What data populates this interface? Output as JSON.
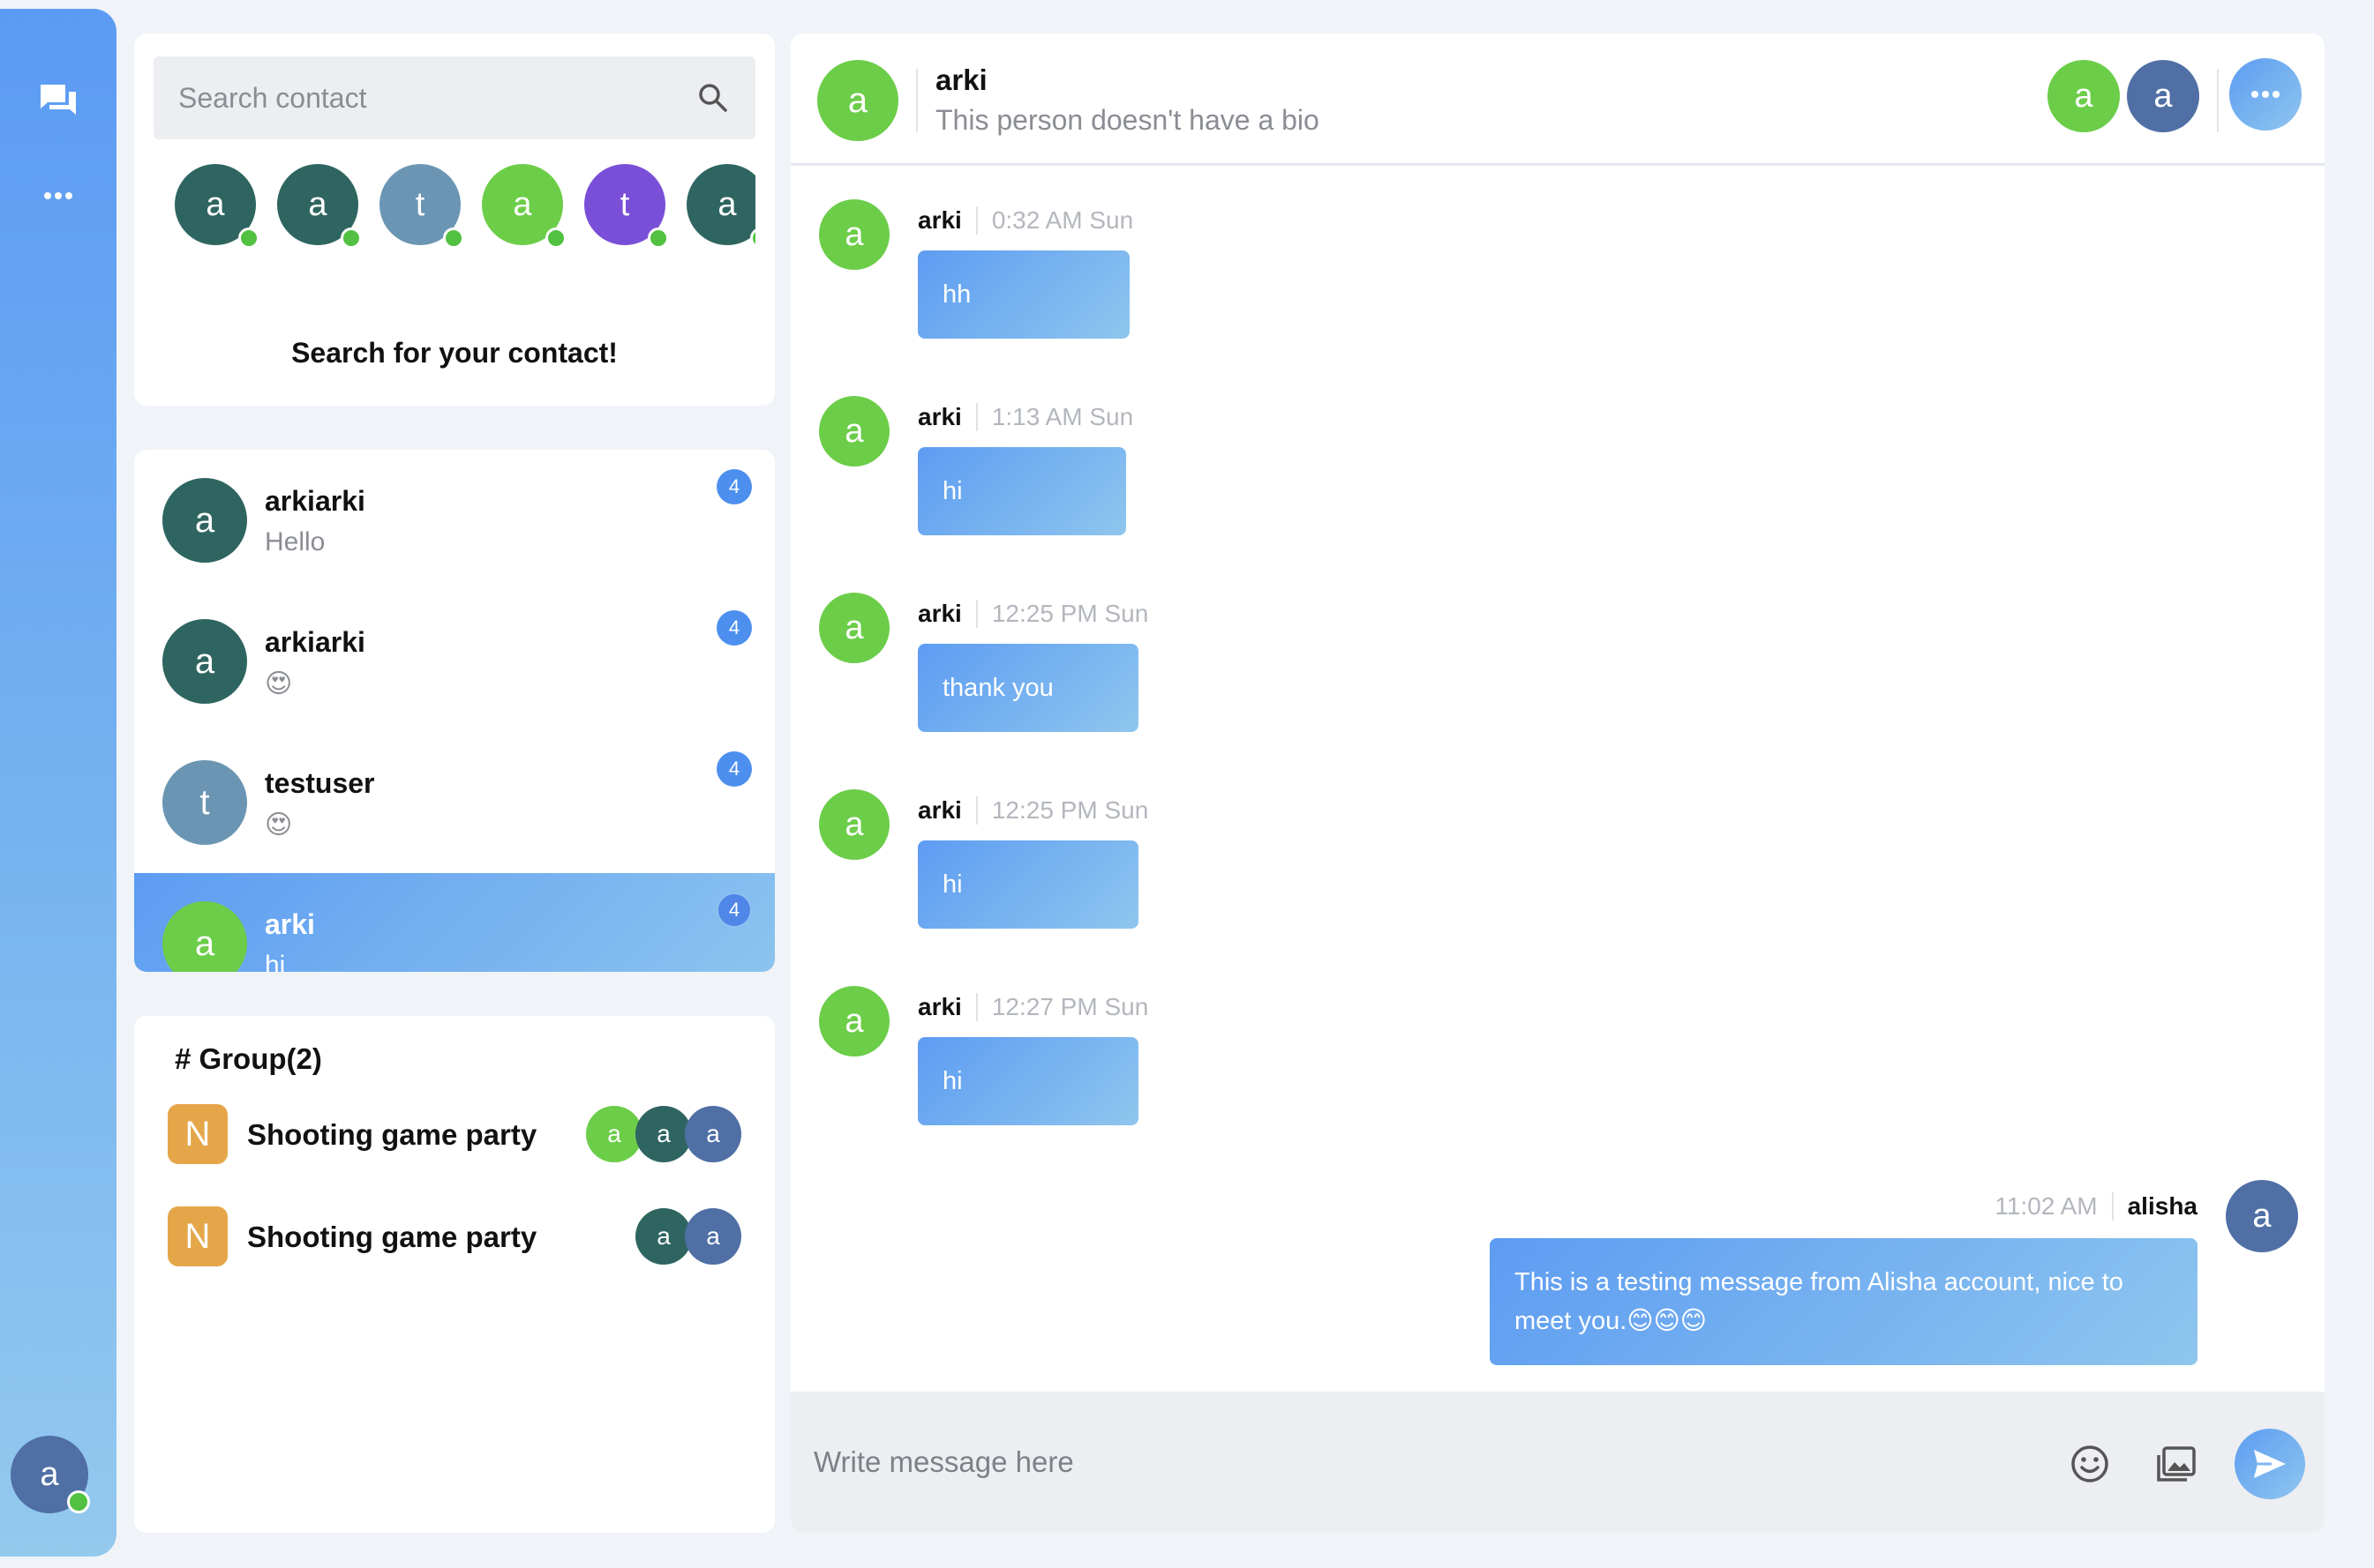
{
  "sidebar": {
    "icons": [
      "chat-icon",
      "more-icon"
    ],
    "user_avatar": "a",
    "user_online": true
  },
  "search": {
    "placeholder": "Search contact",
    "icon": "search-icon",
    "hint": "Search for your contact!",
    "contacts": [
      {
        "initial": "a",
        "color": "#2f6561",
        "online": true
      },
      {
        "initial": "a",
        "color": "#2f6561",
        "online": true
      },
      {
        "initial": "t",
        "color": "#6b96b3",
        "online": true
      },
      {
        "initial": "a",
        "color": "#6ccd49",
        "online": true
      },
      {
        "initial": "t",
        "color": "#7a4fd8",
        "online": true
      },
      {
        "initial": "a",
        "color": "#2f6561",
        "online": true
      }
    ]
  },
  "chats": [
    {
      "initial": "a",
      "color": "#2f6561",
      "name": "arkiarki",
      "preview": "Hello",
      "badge": "4",
      "active": false
    },
    {
      "initial": "a",
      "color": "#2f6561",
      "name": "arkiarki",
      "preview": "😍",
      "badge": "4",
      "active": false
    },
    {
      "initial": "t",
      "color": "#6b96b3",
      "name": "testuser",
      "preview": "😍",
      "badge": "4",
      "active": false
    },
    {
      "initial": "a",
      "color": "#6ccd49",
      "name": "arki",
      "preview": "hi",
      "badge": "4",
      "active": true
    }
  ],
  "groups": {
    "title": "# Group(2)",
    "items": [
      {
        "icon": "N",
        "name": "Shooting game party",
        "members": [
          {
            "initial": "a",
            "color": "#6ccd49"
          },
          {
            "initial": "a",
            "color": "#2f6561"
          },
          {
            "initial": "a",
            "color": "#4f6fa5"
          }
        ]
      },
      {
        "icon": "N",
        "name": "Shooting game party",
        "members": [
          {
            "initial": "a",
            "color": "#2f6561"
          },
          {
            "initial": "a",
            "color": "#4f6fa5"
          }
        ]
      }
    ]
  },
  "conversation": {
    "avatar": "a",
    "name": "arki",
    "bio": "This person doesn't have a bio",
    "members": [
      {
        "initial": "a",
        "color": "#6ccd49"
      },
      {
        "initial": "a",
        "color": "#4f6fa5"
      }
    ],
    "more_icon": "more-icon"
  },
  "messages": [
    {
      "avatar": "a",
      "sender": "arki",
      "time": "0:32 AM Sun",
      "text": "hh"
    },
    {
      "avatar": "a",
      "sender": "arki",
      "time": "1:13 AM Sun",
      "text": "hi"
    },
    {
      "avatar": "a",
      "sender": "arki",
      "time": "12:25 PM Sun",
      "text": "thank you"
    },
    {
      "avatar": "a",
      "sender": "arki",
      "time": "12:25 PM Sun",
      "text": "hi"
    },
    {
      "avatar": "a",
      "sender": "arki",
      "time": "12:27 PM Sun",
      "text": "hi"
    }
  ],
  "own_message": {
    "avatar": "a",
    "sender": "alisha",
    "time": "11:02 AM",
    "text": "This is a testing message from Alisha account, nice to meet you.😊😊😊"
  },
  "composer": {
    "placeholder": "Write message here",
    "icons": [
      "emoji-icon",
      "image-icon",
      "send-icon"
    ]
  }
}
